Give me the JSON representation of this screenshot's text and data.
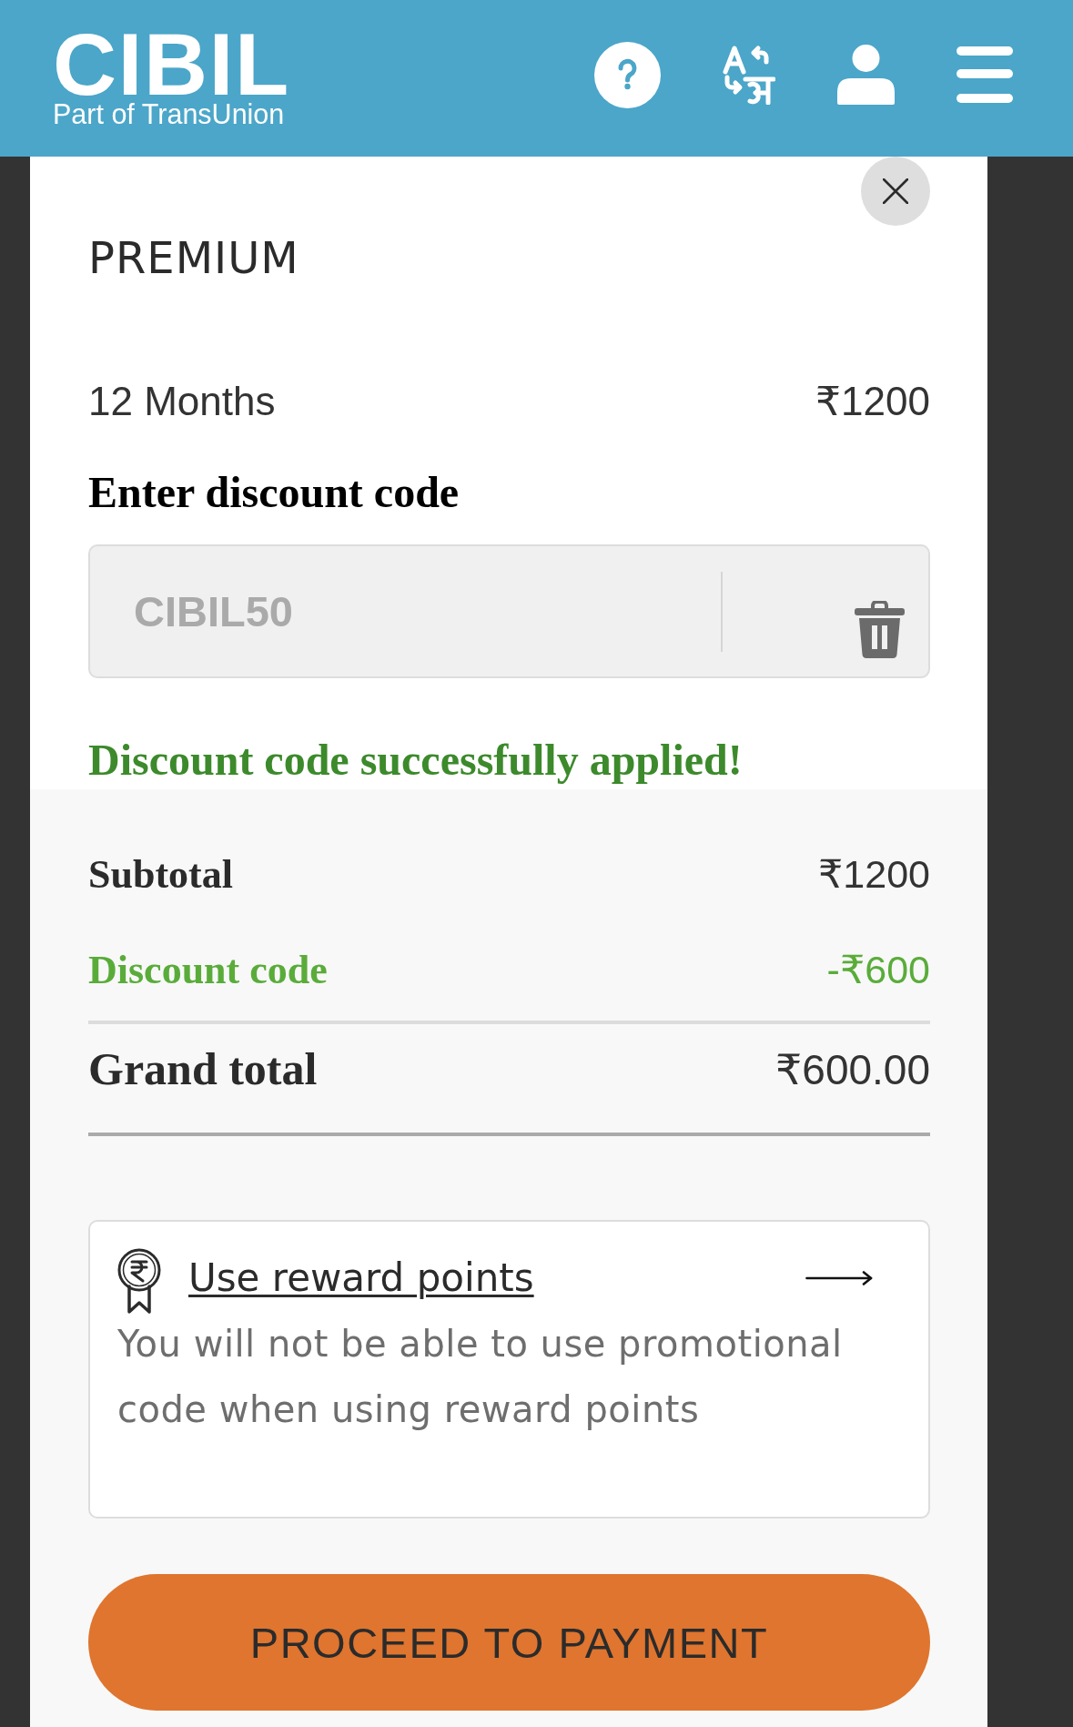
{
  "header": {
    "logo_text": "CIBIL",
    "logo_subtitle": "Part of TransUnion"
  },
  "plan": {
    "name": "PREMIUM",
    "duration": "12 Months",
    "price": "₹1200"
  },
  "discount": {
    "label": "Enter discount code",
    "field": {
      "value": "CIBIL50",
      "disabled": true
    },
    "message": "Discount code successfully applied!"
  },
  "summary": [
    {
      "kind": "subtotal",
      "label": "Subtotal",
      "value": "₹1200"
    },
    {
      "kind": "discount",
      "label": "Discount code",
      "value": "-₹600"
    },
    {
      "kind": "total",
      "label": "Grand total",
      "value": "₹600.00"
    }
  ],
  "rewards": {
    "title": "Use reward points",
    "note": "You will not be able to use promotional code when using reward points"
  },
  "primary_button": {
    "label": "PROCEED TO PAYMENT"
  }
}
